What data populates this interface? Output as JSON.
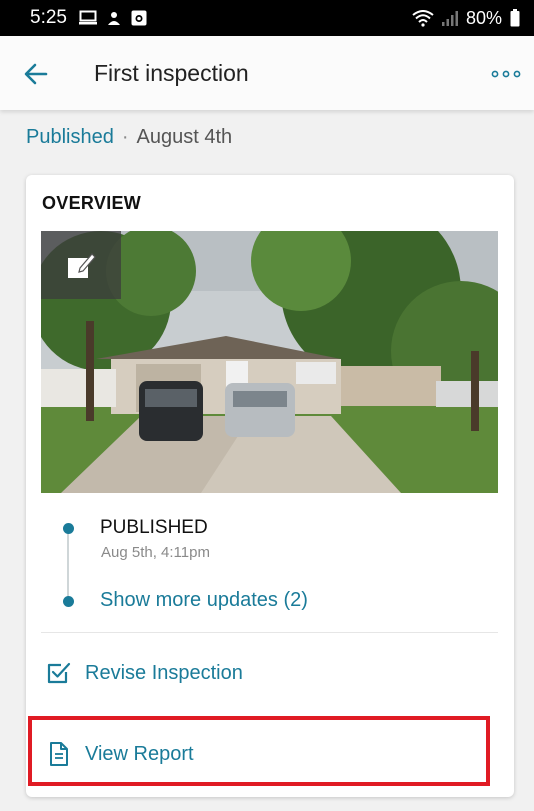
{
  "status_bar": {
    "time": "5:25",
    "battery_percent": "80%",
    "icons": [
      "monitor-icon",
      "cloud-upload-icon",
      "camera-icon",
      "wifi-icon",
      "signal-icon",
      "battery-icon"
    ]
  },
  "app_bar": {
    "title": "First inspection",
    "back_icon": "arrow-left-icon",
    "more_icon": "more-horizontal-icon"
  },
  "meta": {
    "status": "Published",
    "separator": "·",
    "date": "August 4th"
  },
  "overview": {
    "title": "OVERVIEW",
    "photo_edit_icon": "edit-icon",
    "timeline": {
      "status": "PUBLISHED",
      "timestamp": "Aug 5th, 4:11pm",
      "more_updates": "Show more updates (2)"
    },
    "actions": {
      "revise": {
        "label": "Revise Inspection",
        "icon": "checkbox-edit-icon"
      },
      "report": {
        "label": "View Report",
        "icon": "document-icon"
      }
    }
  },
  "colors": {
    "accent": "#1a7b99",
    "highlight": "#e01b24",
    "status_bar": "#000000"
  }
}
